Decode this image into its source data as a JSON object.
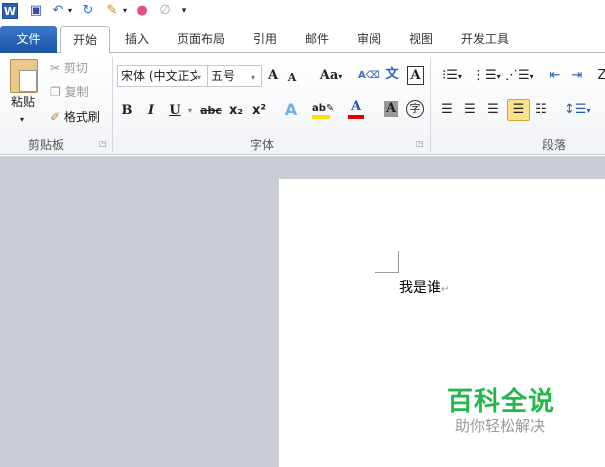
{
  "quick_access": {
    "icons": [
      "word-logo-icon",
      "save-icon",
      "undo-icon",
      "redo-icon",
      "brush-icon",
      "color-wheel-icon",
      "draw-icon",
      "customize-icon"
    ]
  },
  "tabs": [
    {
      "label": "文件"
    },
    {
      "label": "开始"
    },
    {
      "label": "插入"
    },
    {
      "label": "页面布局"
    },
    {
      "label": "引用"
    },
    {
      "label": "邮件"
    },
    {
      "label": "审阅"
    },
    {
      "label": "视图"
    },
    {
      "label": "开发工具"
    }
  ],
  "clipboard": {
    "paste": "粘贴",
    "cut": "剪切",
    "copy": "复制",
    "format_painter": "格式刷",
    "group_label": "剪贴板"
  },
  "font": {
    "font_name": "宋体 (中文正文",
    "font_size": "五号",
    "group_label": "字体",
    "bold": "B",
    "italic": "I",
    "underline": "U",
    "strike": "abc",
    "sub": "x₂",
    "sup": "x²",
    "grow": "A",
    "shrink": "A",
    "case": "Aa"
  },
  "paragraph": {
    "group_label": "段落"
  },
  "document": {
    "text": "我是谁",
    "pilcrow": "↵"
  },
  "watermark": {
    "title": "百科全说",
    "subtitle": "助你轻松解决"
  },
  "colors": {
    "file_tab": "#2a62b5",
    "font_color": "#e00000",
    "highlight": "#ffe000",
    "watermark": "#22b94a",
    "active_toggle": "#fde08a"
  }
}
